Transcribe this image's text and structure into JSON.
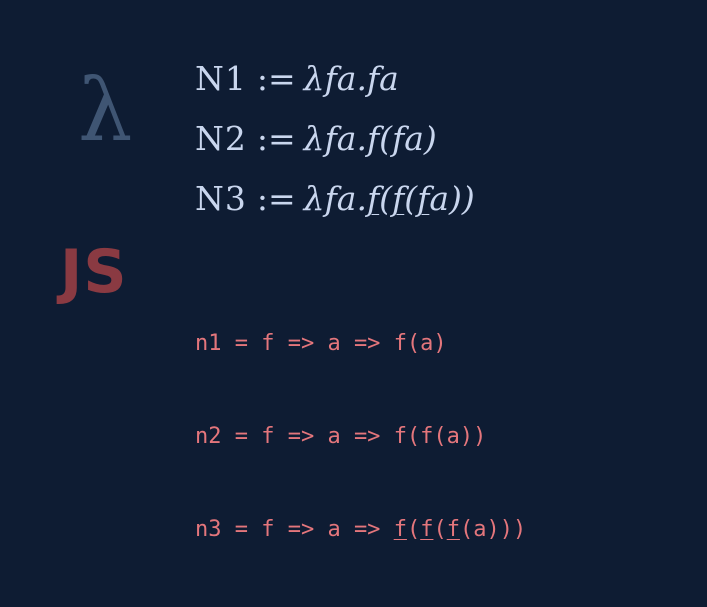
{
  "icons": {
    "lambda": "λ",
    "js": "JS"
  },
  "math": [
    {
      "name": "N1",
      "def": ":=",
      "lambda_head": "λfa.",
      "body": "fa"
    },
    {
      "name": "N2",
      "def": ":=",
      "lambda_head": "λfa.",
      "body": "f(fa)"
    },
    {
      "name": "N3",
      "def": ":=",
      "lambda_head": "λfa.",
      "body": "f(f(fa))"
    }
  ],
  "code": [
    {
      "prefix": "n1 = f => a => ",
      "body": "f(a)"
    },
    {
      "prefix": "n2 = f => a => ",
      "body": "f(f(a))"
    },
    {
      "prefix": "n3 = f => a => ",
      "body": "f(f(f(a)))"
    }
  ],
  "colors": {
    "background": "#0e1c33",
    "math_text": "#c9d6ee",
    "code_text": "#e4767c",
    "lambda_icon": "#3f5573",
    "js_logo": "#8a3a42"
  }
}
